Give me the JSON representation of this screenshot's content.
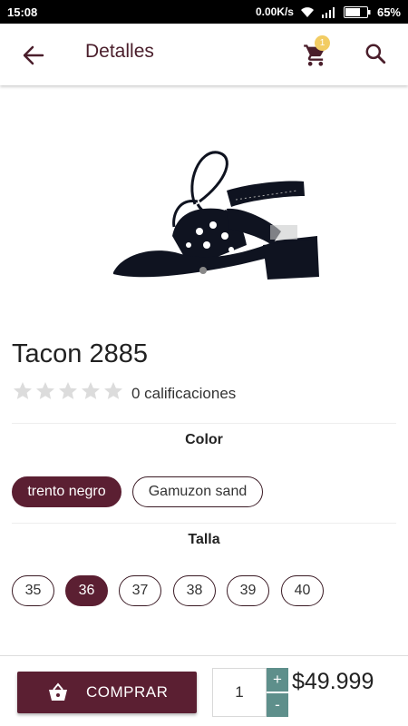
{
  "status_bar": {
    "time": "15:08",
    "speed": "0.00K/s",
    "battery": "65%",
    "wifi_icon": "wifi-icon",
    "signal_icon": "signal-icon",
    "battery_icon": "battery-icon"
  },
  "header": {
    "title": "Detalles",
    "back_icon": "arrow-back-icon",
    "cart_icon": "cart-icon",
    "cart_badge": "1",
    "search_icon": "search-icon"
  },
  "product": {
    "name": "Tacon 2885",
    "rating_count_text": "0 calificaciones",
    "stars": 0,
    "stars_max": 5,
    "price": "$49.999"
  },
  "color_section": {
    "title": "Color",
    "options": [
      "trento negro",
      "Gamuzon sand"
    ],
    "selected": "trento negro"
  },
  "size_section": {
    "title": "Talla",
    "options": [
      "35",
      "36",
      "37",
      "38",
      "39",
      "40"
    ],
    "selected": "36"
  },
  "purchase": {
    "buy_label": "COMPRAR",
    "buy_icon": "basket-icon",
    "quantity": "1",
    "plus": "+",
    "minus": "-"
  },
  "colors": {
    "primary": "#5b1f32",
    "stepper": "#5e8f8b",
    "badge": "#f2cc63"
  }
}
